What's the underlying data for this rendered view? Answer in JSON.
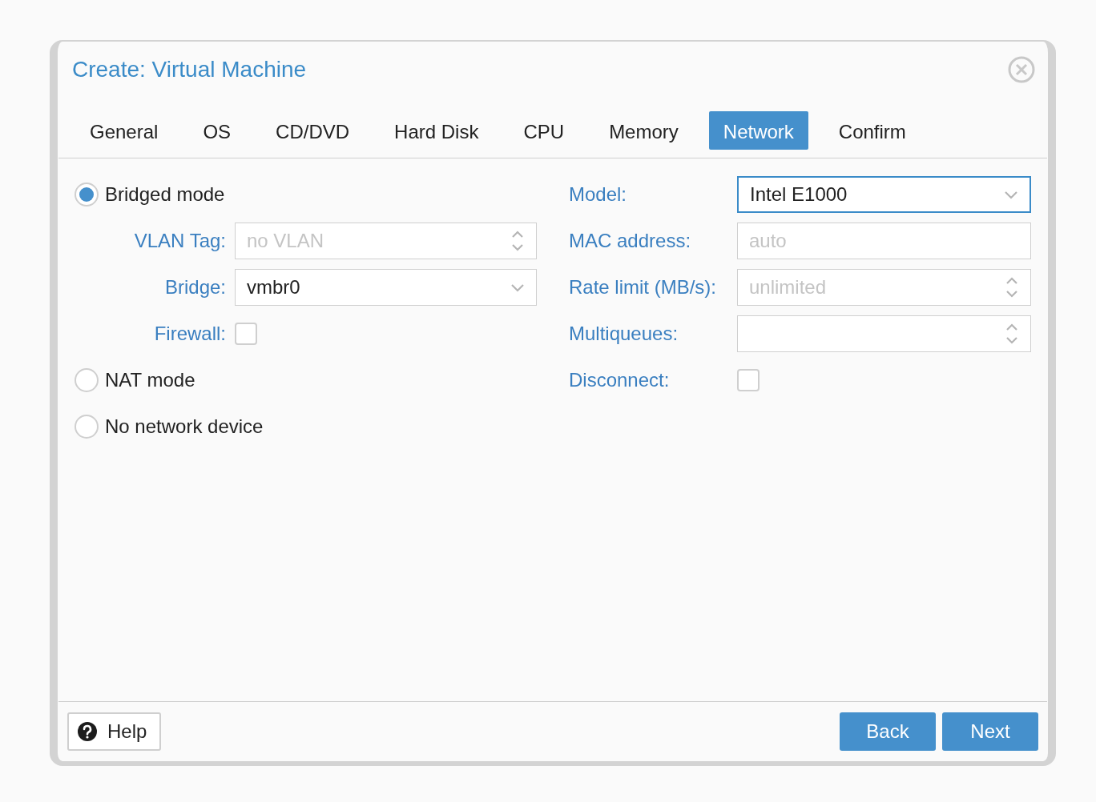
{
  "window": {
    "title": "Create: Virtual Machine"
  },
  "tabs": [
    {
      "label": "General",
      "selected": false
    },
    {
      "label": "OS",
      "selected": false
    },
    {
      "label": "CD/DVD",
      "selected": false
    },
    {
      "label": "Hard Disk",
      "selected": false
    },
    {
      "label": "CPU",
      "selected": false
    },
    {
      "label": "Memory",
      "selected": false
    },
    {
      "label": "Network",
      "selected": true
    },
    {
      "label": "Confirm",
      "selected": false
    }
  ],
  "modes": [
    {
      "label": "Bridged mode",
      "selected": true,
      "fields": [
        {
          "kind": "spinner",
          "label": "VLAN Tag:",
          "placeholder": "no VLAN",
          "focused": false
        },
        {
          "kind": "combo",
          "label": "Bridge:",
          "value": "vmbr0",
          "focused": false
        },
        {
          "kind": "checkbox",
          "label": "Firewall:",
          "checked": false
        }
      ]
    },
    {
      "label": "NAT mode",
      "selected": false
    },
    {
      "label": "No network device",
      "selected": false
    }
  ],
  "device_fields": [
    {
      "kind": "combo",
      "label": "Model:",
      "value": "Intel E1000",
      "focused": true
    },
    {
      "kind": "text",
      "label": "MAC address:",
      "placeholder": "auto",
      "focused": false
    },
    {
      "kind": "spinner",
      "label": "Rate limit (MB/s):",
      "placeholder": "unlimited",
      "focused": false
    },
    {
      "kind": "spinner",
      "label": "Multiqueues:",
      "focused": false
    },
    {
      "kind": "checkbox",
      "label": "Disconnect:",
      "checked": false
    }
  ],
  "footer": {
    "help": "Help",
    "back": "Back",
    "next": "Next"
  }
}
